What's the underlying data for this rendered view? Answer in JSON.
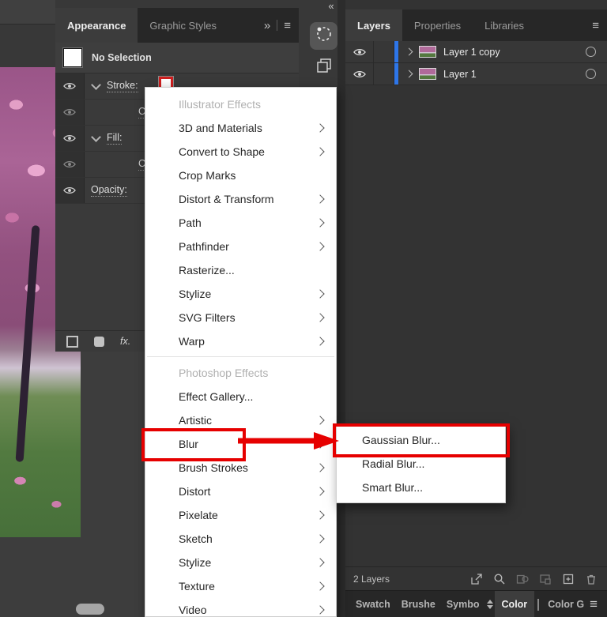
{
  "window": {
    "collapse_dock_icon": "«"
  },
  "appearance_panel": {
    "tabs": [
      {
        "label": "Appearance",
        "active": true
      },
      {
        "label": "Graphic Styles",
        "active": false
      }
    ],
    "overflow_icon": "»",
    "menu_icon": "≡",
    "no_selection_label": "No Selection",
    "rows": [
      {
        "label": "Stroke:",
        "type": "stroke",
        "visible": true
      },
      {
        "label": "Color:",
        "type": "color",
        "visible": true
      },
      {
        "label": "Fill:",
        "type": "fill",
        "visible": true
      },
      {
        "label": "Color:",
        "type": "color",
        "visible": true
      },
      {
        "label": "Opacity:",
        "type": "opacity",
        "visible": true
      }
    ],
    "fx_label": "fx."
  },
  "effect_menu": {
    "header1": "Illustrator Effects",
    "items1": [
      {
        "label": "3D and Materials",
        "has_submenu": true
      },
      {
        "label": "Convert to Shape",
        "has_submenu": true
      },
      {
        "label": "Crop Marks",
        "has_submenu": false
      },
      {
        "label": "Distort & Transform",
        "has_submenu": true
      },
      {
        "label": "Path",
        "has_submenu": true
      },
      {
        "label": "Pathfinder",
        "has_submenu": true
      },
      {
        "label": "Rasterize...",
        "has_submenu": false
      },
      {
        "label": "Stylize",
        "has_submenu": true
      },
      {
        "label": "SVG Filters",
        "has_submenu": true
      },
      {
        "label": "Warp",
        "has_submenu": true
      }
    ],
    "header2": "Photoshop Effects",
    "items2": [
      {
        "label": "Effect Gallery...",
        "has_submenu": false
      },
      {
        "label": "Artistic",
        "has_submenu": true
      },
      {
        "label": "Blur",
        "has_submenu": true,
        "highlighted": true
      },
      {
        "label": "Brush Strokes",
        "has_submenu": true
      },
      {
        "label": "Distort",
        "has_submenu": true
      },
      {
        "label": "Pixelate",
        "has_submenu": true
      },
      {
        "label": "Sketch",
        "has_submenu": true
      },
      {
        "label": "Stylize",
        "has_submenu": true
      },
      {
        "label": "Texture",
        "has_submenu": true
      },
      {
        "label": "Video",
        "has_submenu": true
      }
    ]
  },
  "blur_submenu": {
    "items": [
      {
        "label": "Gaussian Blur...",
        "highlighted": true
      },
      {
        "label": "Radial Blur...",
        "highlighted": false
      },
      {
        "label": "Smart Blur...",
        "highlighted": false
      }
    ]
  },
  "layers_panel": {
    "tabs": [
      {
        "label": "Layers",
        "active": true
      },
      {
        "label": "Properties",
        "active": false
      },
      {
        "label": "Libraries",
        "active": false
      }
    ],
    "menu_icon": "≡",
    "layers": [
      {
        "name": "Layer 1 copy",
        "visible": true,
        "selected": true
      },
      {
        "name": "Layer 1",
        "visible": true,
        "selected": true
      }
    ],
    "status": "2 Layers"
  },
  "bottom_dock": {
    "tabs": [
      {
        "label": "Swatch",
        "active": false
      },
      {
        "label": "Brushe",
        "active": false
      },
      {
        "label": "Symbo",
        "active": false
      },
      {
        "label": "Color",
        "active": true
      },
      {
        "label": "Color G",
        "active": false
      }
    ],
    "menu_icon": "≡",
    "swatch_color": "#e0218a"
  },
  "colors": {
    "highlight_red": "#e60000",
    "selection_blue": "#2e76e8",
    "swatch_magenta": "#e0218a"
  }
}
